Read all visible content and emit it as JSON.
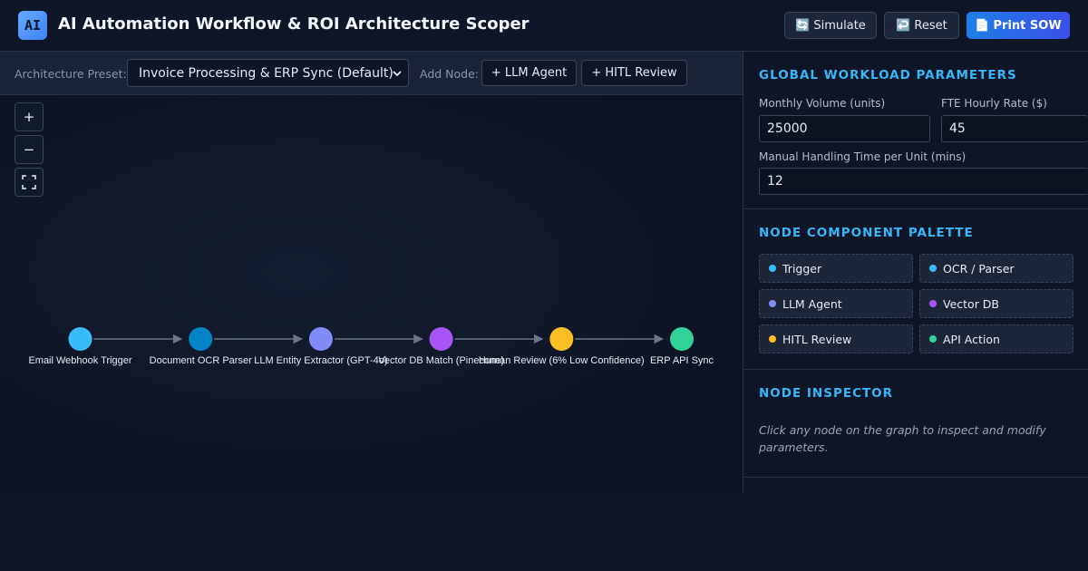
{
  "header": {
    "logo": "AI",
    "title": "AI Automation Workflow & ROI Architecture Scoper",
    "simulate_label": "Simulate",
    "simulate_icon": "🔄",
    "reset_label": "Reset",
    "reset_icon": "↩️",
    "print_label": "Print SOW",
    "print_icon": "📄"
  },
  "toolbar": {
    "preset_label": "Architecture Preset:",
    "preset_value": "Invoice Processing & ERP Sync (Default)",
    "add_node_label": "Add Node:",
    "add_llm_label": "+ LLM Agent",
    "add_hitl_label": "+ HITL Review"
  },
  "zoom": {
    "in": "+",
    "out": "−",
    "fit": "⛶"
  },
  "graph": {
    "nodes": [
      {
        "label": "Email Webhook Trigger",
        "color": "#38bdf8"
      },
      {
        "label": "Document OCR Parser",
        "color": "#0284c7"
      },
      {
        "label": "LLM Entity Extractor (GPT-4o)",
        "color": "#818cf8"
      },
      {
        "label": "Vector DB Match (Pinecone)",
        "color": "#a855f7"
      },
      {
        "label": "Human Review (6% Low Confidence)",
        "color": "#fbbf24"
      },
      {
        "label": "ERP API Sync",
        "color": "#34d399"
      }
    ]
  },
  "workload": {
    "title": "GLOBAL WORKLOAD PARAMETERS",
    "monthly_volume_label": "Monthly Volume (units)",
    "monthly_volume_value": "25000",
    "fte_rate_label": "FTE Hourly Rate ($)",
    "fte_rate_value": "45",
    "handling_time_label": "Manual Handling Time per Unit (mins)",
    "handling_time_value": "12"
  },
  "palette": {
    "title": "NODE COMPONENT PALETTE",
    "items": [
      {
        "label": "Trigger",
        "color": "#38bdf8"
      },
      {
        "label": "OCR / Parser",
        "color": "#38bdf8"
      },
      {
        "label": "LLM Agent",
        "color": "#818cf8"
      },
      {
        "label": "Vector DB",
        "color": "#a855f7"
      },
      {
        "label": "HITL Review",
        "color": "#fbbf24"
      },
      {
        "label": "API Action",
        "color": "#34d399"
      }
    ]
  },
  "inspector": {
    "title": "NODE INSPECTOR",
    "hint": "Click any node on the graph to inspect and modify parameters."
  }
}
